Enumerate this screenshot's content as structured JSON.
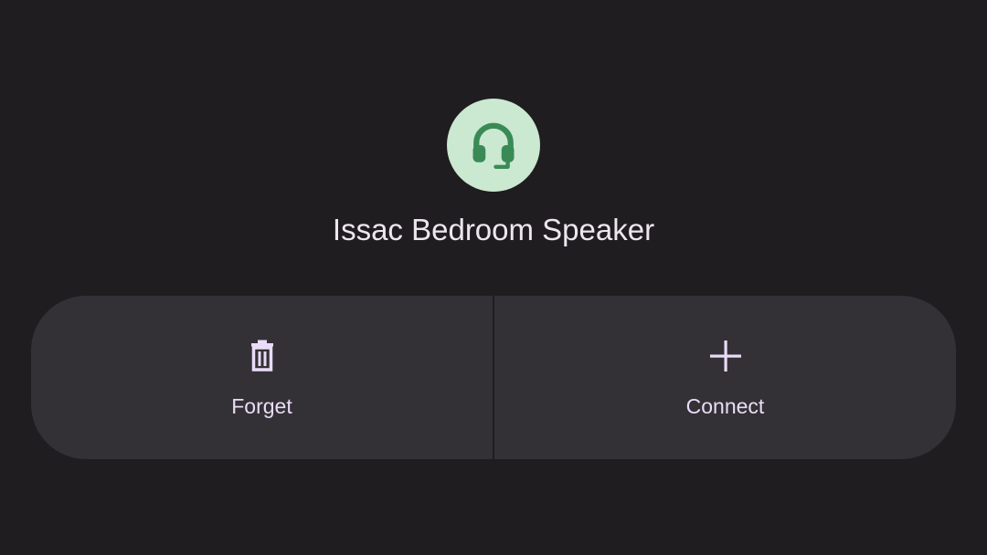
{
  "device": {
    "name": "Issac Bedroom Speaker",
    "icon": "headset-icon"
  },
  "actions": [
    {
      "label": "Forget",
      "icon": "trash-icon"
    },
    {
      "label": "Connect",
      "icon": "plus-icon"
    }
  ],
  "colors": {
    "background": "#1f1d20",
    "panel": "#333135",
    "avatar_bg": "#cbe8d1",
    "avatar_icon": "#3a8a55",
    "accent": "#eadcf8",
    "text": "#ece6ee"
  }
}
